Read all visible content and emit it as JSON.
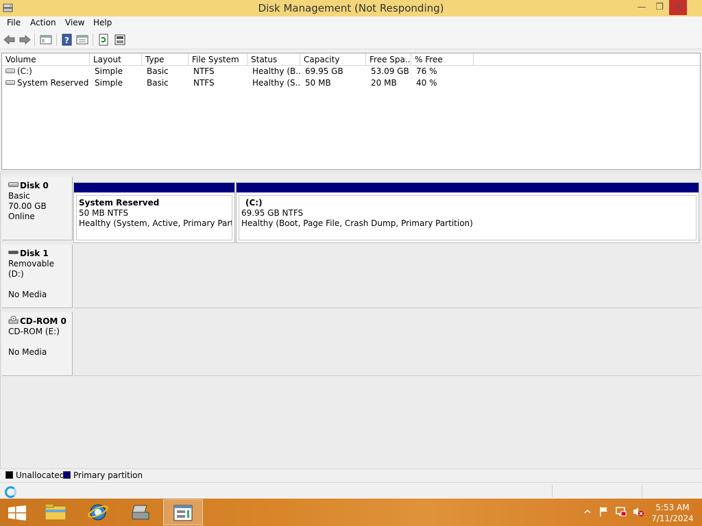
{
  "window": {
    "title": "Disk Management (Not Responding)",
    "minimize_icon": "minimize-icon",
    "maximize_icon": "restore-icon",
    "close_icon": "close-icon",
    "min_glyph": "—",
    "max_glyph": "❐",
    "close_glyph": "✕"
  },
  "menu": [
    "File",
    "Action",
    "View",
    "Help"
  ],
  "toolbar": [
    "back-icon",
    "forward-icon",
    "show-hide-console-tree-icon",
    "help-icon",
    "properties-icon",
    "refresh-icon",
    "rescan-disks-icon"
  ],
  "volume_table": {
    "columns": [
      "Volume",
      "Layout",
      "Type",
      "File System",
      "Status",
      "Capacity",
      "Free Spa...",
      "% Free"
    ],
    "rows": [
      [
        "(C:)",
        "Simple",
        "Basic",
        "NTFS",
        "Healthy (B...",
        "69.95 GB",
        "53.09 GB",
        "76 %"
      ],
      [
        "System Reserved",
        "Simple",
        "Basic",
        "NTFS",
        "Healthy (S...",
        "50 MB",
        "20 MB",
        "40 %"
      ]
    ]
  },
  "disks": [
    {
      "name": "Disk 0",
      "lines": [
        "Basic",
        "70.00 GB",
        "Online"
      ],
      "partitions": [
        {
          "name": "System Reserved",
          "size": "50 MB NTFS",
          "status": "Healthy (System, Active, Primary Partition"
        },
        {
          "name": "(C:)",
          "size": "69.95 GB NTFS",
          "status": "Healthy (Boot, Page File, Crash Dump, Primary Partition)"
        }
      ]
    },
    {
      "name": "Disk 1",
      "lines": [
        "Removable (D:)",
        "",
        "No Media"
      ]
    },
    {
      "name": "CD-ROM 0",
      "lines": [
        "CD-ROM (E:)",
        "",
        "No Media"
      ]
    }
  ],
  "legend": [
    {
      "label": "Unallocated",
      "color": "#000000"
    },
    {
      "label": "Primary partition",
      "color": "#00007f"
    }
  ],
  "colors": {
    "titlebar": "#f4d67a",
    "close_button": "#c7302a",
    "primary_partition": "#00007f",
    "taskbar": "#d9862a"
  },
  "taskbar": {
    "items": [
      "start-icon",
      "file-explorer-icon",
      "internet-explorer-icon",
      "computer-management-icon",
      "disk-management-icon"
    ],
    "tray_icons": [
      "show-hidden-icons-icon",
      "action-center-flag-icon",
      "network-icon",
      "speaker-muted-icon"
    ],
    "time": "5:53 AM",
    "date": "7/11/2024"
  }
}
